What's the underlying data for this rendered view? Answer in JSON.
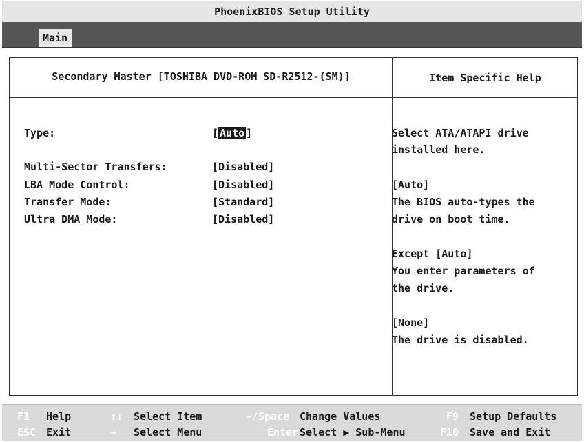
{
  "title": "PhoenixBIOS Setup Utility",
  "menu": {
    "tabs": [
      {
        "label": "Main",
        "active": true
      }
    ]
  },
  "panel": {
    "left_header": "Secondary Master [TOSHIBA DVD-ROM SD-R2512-(SM)]",
    "right_header": "Item Specific Help"
  },
  "settings": [
    {
      "label": "Type:",
      "value": "Auto",
      "selected": true
    },
    {
      "label": "Multi-Sector Transfers:",
      "value": "[Disabled]"
    },
    {
      "label": "LBA Mode Control:",
      "value": "[Disabled]"
    },
    {
      "label": "Transfer Mode:",
      "value": "[Standard]"
    },
    {
      "label": "Ultra DMA Mode:",
      "value": "[Disabled]"
    }
  ],
  "help_lines": [
    "Select ATA/ATAPI drive",
    "installed here.",
    "[Auto]",
    "The BIOS auto-types the",
    "drive on boot time.",
    "Except [Auto]",
    "You enter parameters of",
    "the drive.",
    "[None]",
    "The drive is disabled."
  ],
  "footer": {
    "row1": [
      {
        "key": "F1",
        "action": "Help"
      },
      {
        "key": "↑↓",
        "action": "Select Item"
      },
      {
        "key": "-/Space",
        "action": "Change Values"
      },
      {
        "key": "F9",
        "action": "Setup Defaults"
      }
    ],
    "row2": [
      {
        "key": "ESC",
        "action": "Exit"
      },
      {
        "key": "↔",
        "action": "Select Menu"
      },
      {
        "key": "Enter",
        "action": "Select ▶ Sub-Menu"
      },
      {
        "key": "F10",
        "action": "Save and Exit"
      }
    ]
  },
  "colors": {
    "menubar": "#555555",
    "selection": "#1a1a1a",
    "footer_bg": "#dadada",
    "key_text": "#ffffff"
  }
}
